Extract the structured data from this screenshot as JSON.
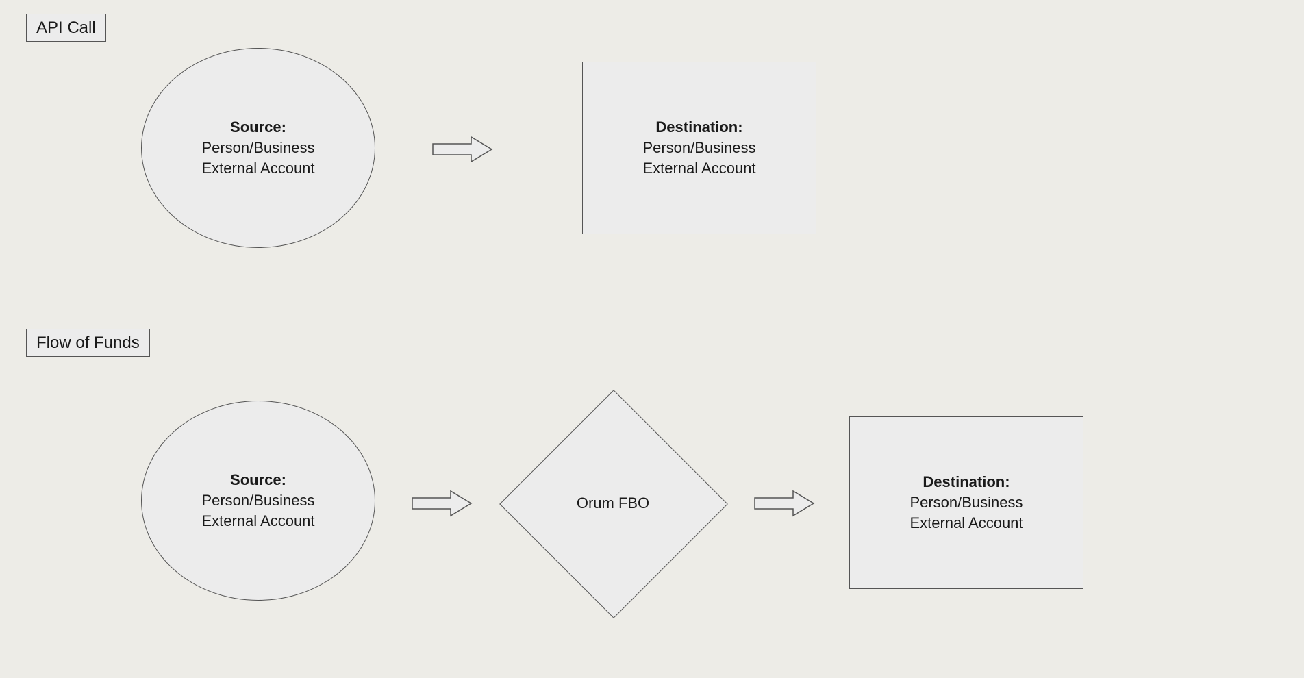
{
  "sections": {
    "api_call": {
      "label": "API Call"
    },
    "flow_of_funds": {
      "label": "Flow of Funds"
    }
  },
  "api_call": {
    "source": {
      "title": "Source:",
      "line1": "Person/Business",
      "line2": "External Account"
    },
    "destination": {
      "title": "Destination:",
      "line1": "Person/Business",
      "line2": "External Account"
    }
  },
  "flow_of_funds": {
    "source": {
      "title": "Source:",
      "line1": "Person/Business",
      "line2": "External Account"
    },
    "middle": {
      "text": "Orum FBO"
    },
    "destination": {
      "title": "Destination:",
      "line1": "Person/Business",
      "line2": "External Account"
    }
  }
}
